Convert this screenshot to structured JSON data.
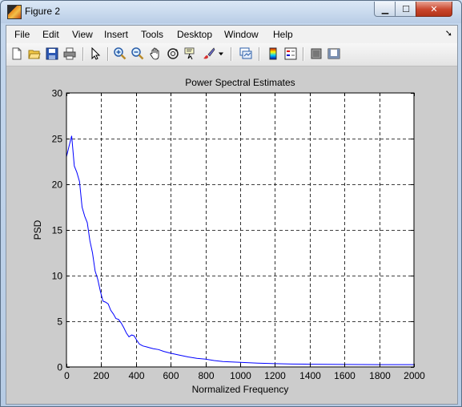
{
  "window": {
    "title": "Figure 2"
  },
  "menu": {
    "items": [
      "File",
      "Edit",
      "View",
      "Insert",
      "Tools",
      "Desktop",
      "Window",
      "Help"
    ]
  },
  "toolbar": {
    "icons": [
      "new-figure-icon",
      "open-file-icon",
      "save-icon",
      "print-icon",
      "edit-plot-arrow-icon",
      "zoom-in-icon",
      "zoom-out-icon",
      "pan-hand-icon",
      "rotate-3d-icon",
      "data-cursor-icon",
      "brush-icon",
      "link-plot-icon",
      "insert-colorbar-icon",
      "insert-legend-icon",
      "hide-plot-tools-icon",
      "show-plot-tools-icon"
    ]
  },
  "chart_data": {
    "type": "line",
    "title": "Power Spectral Estimates",
    "xlabel": "Normalized Frequency",
    "ylabel": "PSD",
    "xlim": [
      0,
      2000
    ],
    "ylim": [
      0,
      30
    ],
    "xticks": [
      0,
      200,
      400,
      600,
      800,
      1000,
      1200,
      1400,
      1600,
      1800,
      2000
    ],
    "yticks": [
      0,
      5,
      10,
      15,
      20,
      25,
      30
    ],
    "grid": true,
    "series": [
      {
        "color": "#0000ff",
        "x": [
          0,
          15,
          30,
          45,
          60,
          75,
          90,
          105,
          120,
          135,
          150,
          165,
          180,
          195,
          210,
          225,
          240,
          255,
          270,
          285,
          300,
          315,
          330,
          345,
          360,
          375,
          390,
          405,
          420,
          440,
          460,
          480,
          500,
          530,
          560,
          600,
          650,
          700,
          750,
          800,
          850,
          900,
          950,
          1000,
          1100,
          1200,
          1300,
          1400,
          1500,
          1600,
          1700,
          1800,
          1900,
          2000
        ],
        "y": [
          23.0,
          24.2,
          25.3,
          22.0,
          21.3,
          20.3,
          17.5,
          16.5,
          15.8,
          13.8,
          12.5,
          10.5,
          9.6,
          8.3,
          7.2,
          7.1,
          6.9,
          6.2,
          5.8,
          5.3,
          5.2,
          4.8,
          4.3,
          3.7,
          3.3,
          3.5,
          3.4,
          2.9,
          2.5,
          2.3,
          2.2,
          2.1,
          2.0,
          1.9,
          1.7,
          1.5,
          1.3,
          1.1,
          0.95,
          0.85,
          0.7,
          0.6,
          0.55,
          0.5,
          0.42,
          0.36,
          0.32,
          0.3,
          0.28,
          0.27,
          0.26,
          0.25,
          0.25,
          0.25
        ]
      }
    ]
  }
}
